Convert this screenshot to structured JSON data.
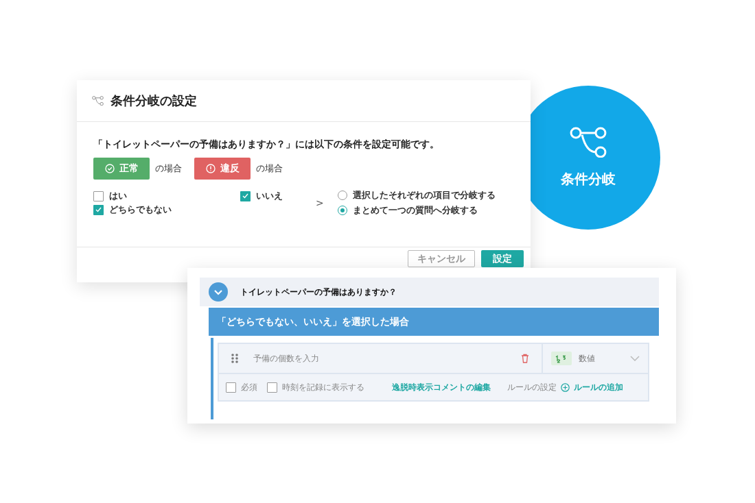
{
  "dialog": {
    "title": "条件分岐の設定",
    "question": "「トイレットペーパーの予備はありますか？」には以下の条件を設定可能です。",
    "statuses": [
      {
        "kind": "normal",
        "label": "正常",
        "suffix": "の場合",
        "selected": true
      },
      {
        "kind": "violation",
        "label": "違反",
        "suffix": "の場合",
        "selected": true
      }
    ],
    "options": [
      {
        "label": "はい",
        "checked": false
      },
      {
        "label": "いいえ",
        "checked": true
      },
      {
        "label": "どちらでもない",
        "checked": true
      }
    ],
    "arrow": ">",
    "radios": [
      {
        "label": "選択したそれぞれの項目で分岐する",
        "selected": false
      },
      {
        "label": "まとめて一つの質問へ分岐する",
        "selected": true
      }
    ],
    "buttons": [
      {
        "kind": "secondary",
        "label": "キャンセル"
      },
      {
        "kind": "primary",
        "label": "設定"
      }
    ]
  },
  "badge": {
    "label": "条件分岐"
  },
  "card": {
    "question": "トイレットペーパーの予備はありますか？",
    "branch": "「どちらでもない、いいえ」を選択した場合",
    "field": {
      "placeholder": "予備の個数を入力",
      "type_label": "数値"
    },
    "settings": [
      {
        "label": "必須",
        "checked": false
      },
      {
        "label": "時刻を記録に表示する",
        "checked": false
      }
    ],
    "edit_link": "逸脱時表示コメントの編集",
    "rule_label": "ルールの設定",
    "add_rule": "ルールの追加"
  }
}
